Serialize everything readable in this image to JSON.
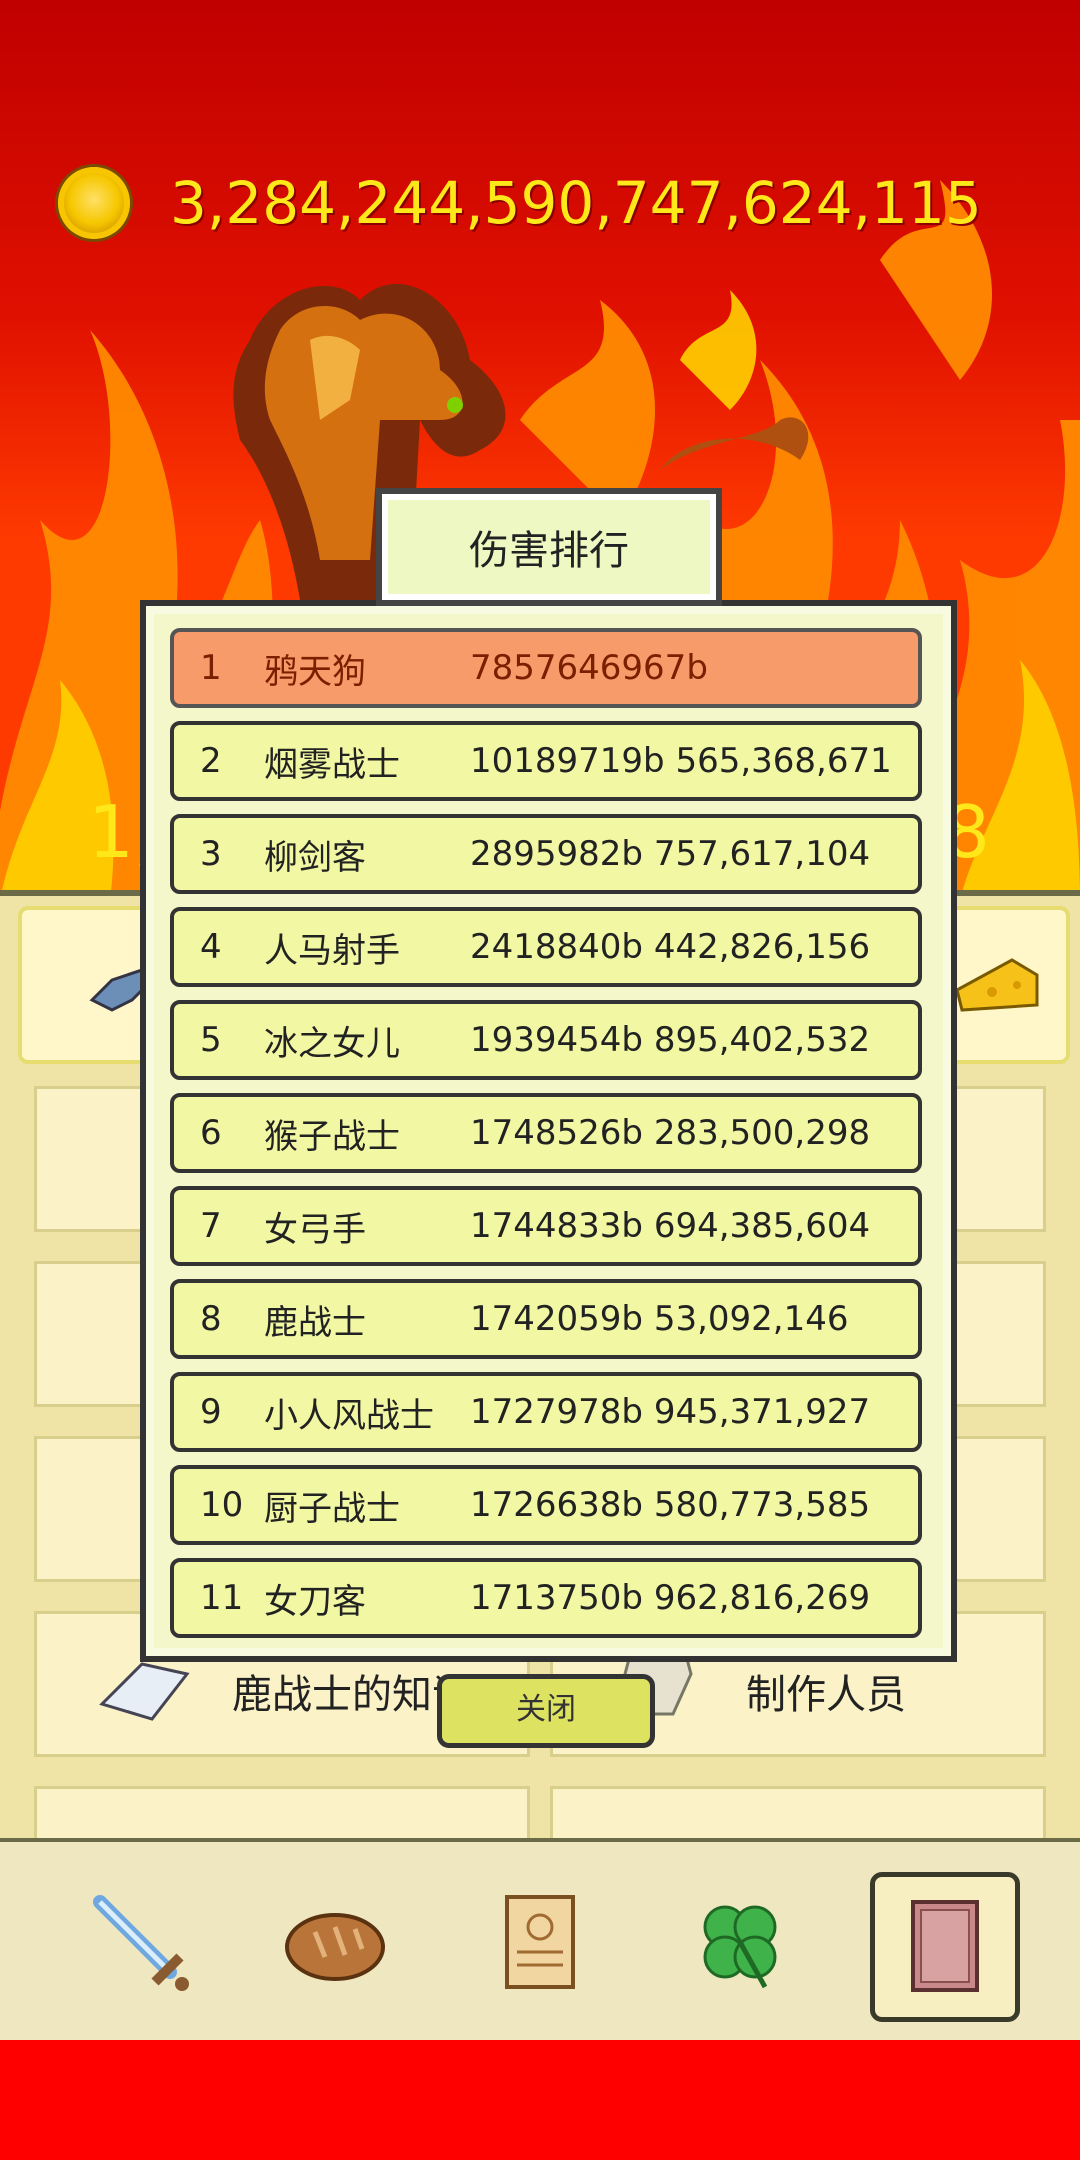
{
  "currency": {
    "amount": "3,284,244,590,747,624,115",
    "icon": "gold-coin-icon"
  },
  "behind": {
    "partial_left": "1,",
    "partial_right": "8",
    "menu_left_label": "鹿战士的知识",
    "menu_right_label": "制作人员"
  },
  "modal": {
    "title": "伤害排行",
    "close_label": "关闭",
    "rows": [
      {
        "rank": "1",
        "name": "鸦天狗",
        "score": "7857646967b"
      },
      {
        "rank": "2",
        "name": "烟雾战士",
        "score": "10189719b 565,368,671"
      },
      {
        "rank": "3",
        "name": "柳剑客",
        "score": "2895982b 757,617,104"
      },
      {
        "rank": "4",
        "name": "人马射手",
        "score": "2418840b 442,826,156"
      },
      {
        "rank": "5",
        "name": "冰之女儿",
        "score": "1939454b 895,402,532"
      },
      {
        "rank": "6",
        "name": "猴子战士",
        "score": "1748526b 283,500,298"
      },
      {
        "rank": "7",
        "name": "女弓手",
        "score": "1744833b 694,385,604"
      },
      {
        "rank": "8",
        "name": "鹿战士",
        "score": "1742059b 53,092,146"
      },
      {
        "rank": "9",
        "name": "小人风战士",
        "score": "1727978b 945,371,927"
      },
      {
        "rank": "10",
        "name": "厨子战士",
        "score": "1726638b 580,773,585"
      },
      {
        "rank": "11",
        "name": "女刀客",
        "score": "1713750b 962,816,269"
      }
    ]
  },
  "nav": [
    {
      "icon": "sword-icon"
    },
    {
      "icon": "bread-icon"
    },
    {
      "icon": "scroll-icon"
    },
    {
      "icon": "clover-icon"
    },
    {
      "icon": "book-icon",
      "active": true
    }
  ],
  "colors": {
    "background_red": "#c40000",
    "coin_text": "#ffe81a",
    "row_fill": "#f1f7a3",
    "first_row_fill": "#f79b6a"
  }
}
